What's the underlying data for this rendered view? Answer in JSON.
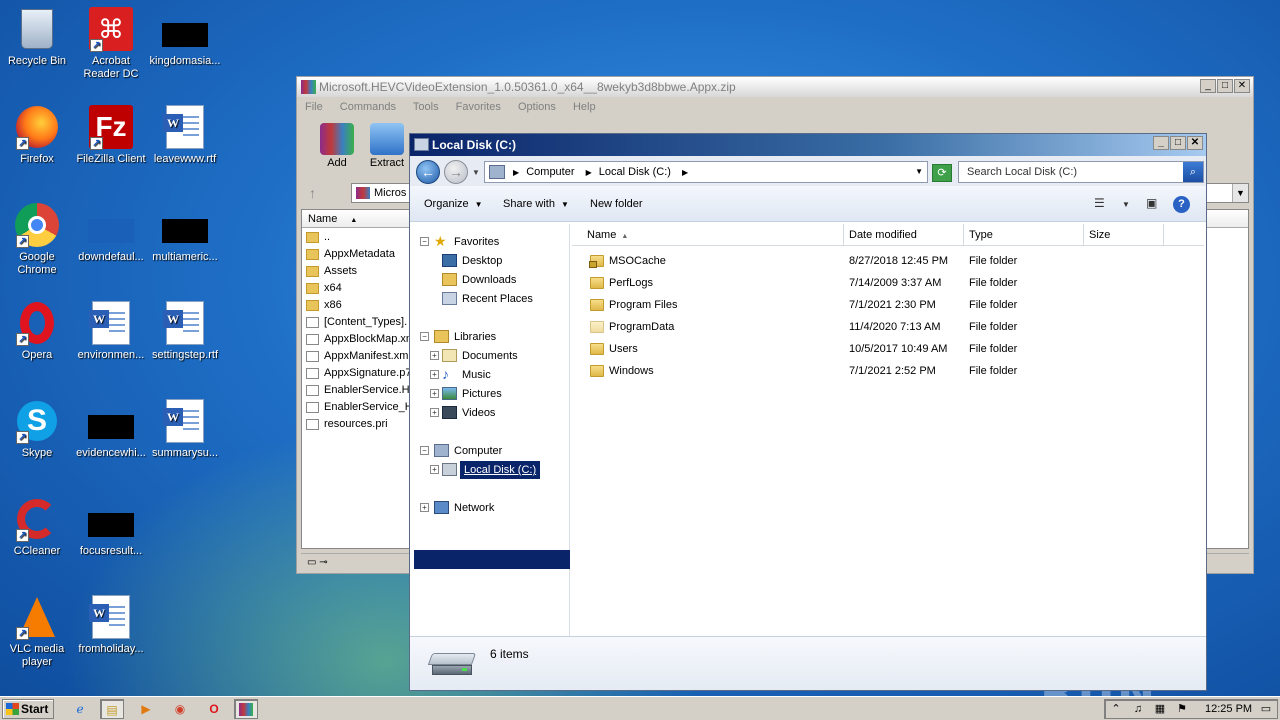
{
  "desktop": {
    "icons": [
      {
        "name": "recycle-bin",
        "label": "Recycle Bin"
      },
      {
        "name": "acrobat",
        "label": "Acrobat Reader DC"
      },
      {
        "name": "kingdomasia",
        "label": "kingdomasia..."
      },
      {
        "name": "firefox",
        "label": "Firefox"
      },
      {
        "name": "filezilla",
        "label": "FileZilla Client"
      },
      {
        "name": "leavewww",
        "label": "leavewww.rtf"
      },
      {
        "name": "chrome",
        "label": "Google Chrome"
      },
      {
        "name": "downdefaul",
        "label": "downdefaul..."
      },
      {
        "name": "multiameric",
        "label": "multiameric..."
      },
      {
        "name": "opera",
        "label": "Opera"
      },
      {
        "name": "environmen",
        "label": "environmen..."
      },
      {
        "name": "settingstep",
        "label": "settingstep.rtf"
      },
      {
        "name": "skype",
        "label": "Skype"
      },
      {
        "name": "evidencewhi",
        "label": "evidencewhi..."
      },
      {
        "name": "summarysu",
        "label": "summarysu..."
      },
      {
        "name": "ccleaner",
        "label": "CCleaner"
      },
      {
        "name": "focusresult",
        "label": "focusresult..."
      },
      {
        "name": "vlc",
        "label": "VLC media player"
      },
      {
        "name": "fromholiday",
        "label": "fromholiday..."
      }
    ]
  },
  "winrar": {
    "title": "Microsoft.HEVCVideoExtension_1.0.50361.0_x64__8wekyb3d8bbwe.Appx.zip",
    "menu": [
      "File",
      "Commands",
      "Tools",
      "Favorites",
      "Options",
      "Help"
    ],
    "toolbar": {
      "add": "Add",
      "extract": "Extract"
    },
    "path_text": "Micros",
    "column_name": "Name",
    "files": [
      {
        "name": "..",
        "kind": "folder"
      },
      {
        "name": "AppxMetadata",
        "kind": "folder"
      },
      {
        "name": "Assets",
        "kind": "folder"
      },
      {
        "name": "x64",
        "kind": "folder"
      },
      {
        "name": "x86",
        "kind": "folder"
      },
      {
        "name": "[Content_Types].",
        "kind": "file"
      },
      {
        "name": "AppxBlockMap.xm",
        "kind": "file"
      },
      {
        "name": "AppxManifest.xm",
        "kind": "file"
      },
      {
        "name": "AppxSignature.p7",
        "kind": "file"
      },
      {
        "name": "EnablerService.H.",
        "kind": "file"
      },
      {
        "name": "EnablerService_H",
        "kind": "file"
      },
      {
        "name": "resources.pri",
        "kind": "file"
      }
    ]
  },
  "explorer": {
    "title": "Local Disk (C:)",
    "breadcrumb": [
      "Computer",
      "Local Disk (C:)"
    ],
    "search_placeholder": "Search Local Disk (C:)",
    "commands": {
      "organize": "Organize",
      "share_with": "Share with",
      "new_folder": "New folder"
    },
    "nav": {
      "favorites": "Favorites",
      "desktop": "Desktop",
      "downloads": "Downloads",
      "recent_places": "Recent Places",
      "libraries": "Libraries",
      "documents": "Documents",
      "music": "Music",
      "pictures": "Pictures",
      "videos": "Videos",
      "computer": "Computer",
      "local_disk": "Local Disk (C:)",
      "network": "Network"
    },
    "columns": {
      "name": "Name",
      "date_modified": "Date modified",
      "type": "Type",
      "size": "Size"
    },
    "rows": [
      {
        "name": "MSOCache",
        "date": "8/27/2018 12:45 PM",
        "type": "File folder",
        "icon": "locked-folder-icon"
      },
      {
        "name": "PerfLogs",
        "date": "7/14/2009 3:37 AM",
        "type": "File folder",
        "icon": "folder-icon"
      },
      {
        "name": "Program Files",
        "date": "7/1/2021 2:30 PM",
        "type": "File folder",
        "icon": "folder-icon"
      },
      {
        "name": "ProgramData",
        "date": "11/4/2020 7:13 AM",
        "type": "File folder",
        "icon": "hidden-folder-icon"
      },
      {
        "name": "Users",
        "date": "10/5/2017 10:49 AM",
        "type": "File folder",
        "icon": "folder-icon"
      },
      {
        "name": "Windows",
        "date": "7/1/2021 2:52 PM",
        "type": "File folder",
        "icon": "folder-icon"
      }
    ],
    "status": "6 items"
  },
  "taskbar": {
    "start": "Start",
    "clock": "12:25 PM"
  },
  "watermark": "ANY RUN",
  "colors": {
    "title_active": "#0a246a",
    "desktop_blue": "#1f6fc7",
    "folder_yellow": "#e8c45a"
  }
}
